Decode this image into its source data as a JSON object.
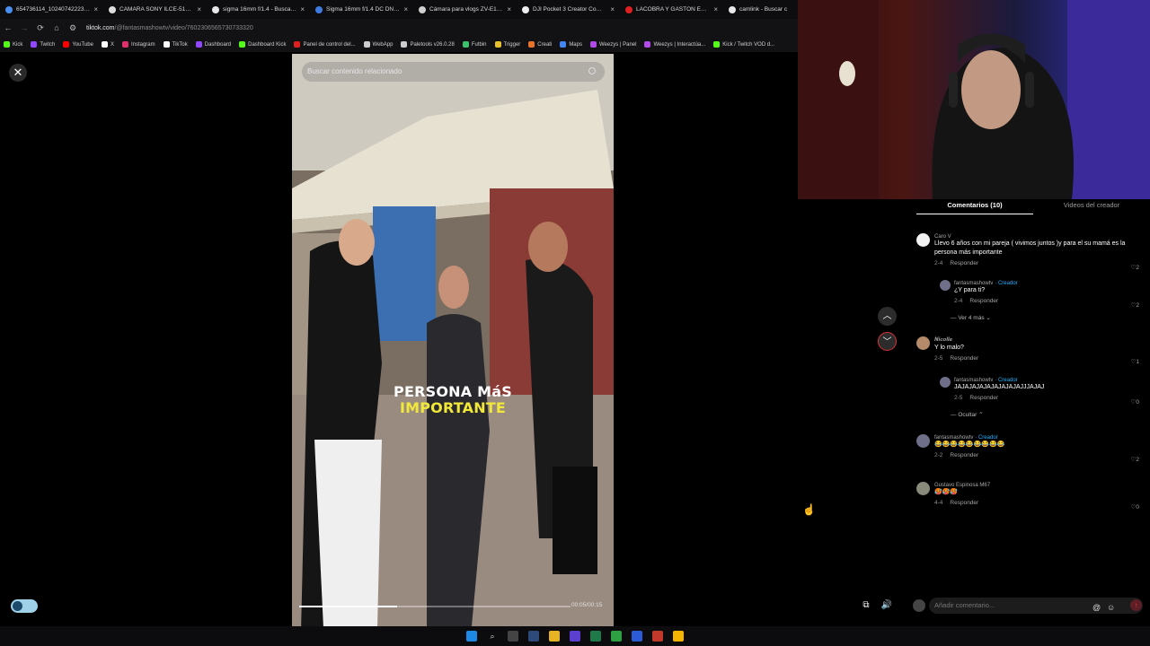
{
  "browser": {
    "tabs": [
      {
        "title": "654736114_1024074222303978...",
        "color": "#4a8ef0"
      },
      {
        "title": "CAMARA SONY ILCE-5100 -",
        "color": "#dddddd"
      },
      {
        "title": "sigma 16mm f/1.4 - Buscar co",
        "color": "#e8e8e8"
      },
      {
        "title": "Sigma 16mm f/1.4 DC DN Co",
        "color": "#3d7be0"
      },
      {
        "title": "Cámara para vlogs ZV-E10 II",
        "color": "#cfcfcf"
      },
      {
        "title": "DJI Pocket 3 Creator Combo",
        "color": "#eeeeee"
      },
      {
        "title": "LACOBRA Y GASTÓN EDUL D",
        "color": "#e02020"
      },
      {
        "title": "camlink - Buscar c",
        "color": "#e8e8e8"
      }
    ],
    "url_host": "tiktok.com",
    "url_path": "/@fantasmashowtv/video/7602306565730733320",
    "bookmarks": [
      {
        "label": "Kick",
        "color": "#53fc18"
      },
      {
        "label": "Twitch",
        "color": "#9146ff"
      },
      {
        "label": "YouTube",
        "color": "#ff0000"
      },
      {
        "label": "X",
        "color": "#ffffff"
      },
      {
        "label": "Instagram",
        "color": "#e1306c"
      },
      {
        "label": "TikTok",
        "color": "#ffffff"
      },
      {
        "label": "Dashboard",
        "color": "#9146ff"
      },
      {
        "label": "Dashboard Kick",
        "color": "#53fc18"
      },
      {
        "label": "Panel de control del...",
        "color": "#e02020"
      },
      {
        "label": "WebApp",
        "color": "#cccccc"
      },
      {
        "label": "Paletools v26.0.28",
        "color": "#cccccc"
      },
      {
        "label": "Futbin",
        "color": "#3cc26a"
      },
      {
        "label": "Trigger",
        "color": "#e6c12a"
      },
      {
        "label": "Creati",
        "color": "#e8742a"
      },
      {
        "label": "Maps",
        "color": "#4285f4"
      },
      {
        "label": "Weezys | Panel",
        "color": "#b04ae8"
      },
      {
        "label": "Weezys | Interactúa...",
        "color": "#b04ae8"
      },
      {
        "label": "Kick / Twitch VOD d...",
        "color": "#53fc18"
      }
    ]
  },
  "video": {
    "search_placeholder": "Buscar contenido relacionado",
    "caption_line1": "PERSONA MáS",
    "caption_line2": "IMPORTANTE",
    "caption_color1": "#ffffff",
    "caption_color2": "#f2e83a",
    "time": "00:05/00:15",
    "progress": 0.36
  },
  "panel": {
    "tab_comments": "Comentarios (10)",
    "tab_videos": "Videos del creador",
    "input_placeholder": "Añadir comentario...",
    "comments": [
      {
        "user": "Caro V",
        "text": "Llevo 6 años con mi pareja ( vivimos juntos )y para el su mamá es la persona más importante",
        "date": "2-4",
        "likes": "2"
      },
      {
        "user": "fantasmashowtv",
        "badge": "· Creador",
        "text": "¿Y para ti?",
        "date": "2-4",
        "likes": "2"
      },
      {
        "more": "Ver 4 más"
      },
      {
        "user": "𝑵𝒊𝒄𝒐𝒍𝒍𝒆",
        "text": "Y lo malo?",
        "date": "2-5",
        "likes": "1"
      },
      {
        "user": "fantasmashowtv",
        "badge": "· Creador",
        "text": "JAJAJAJAJAJAJAJAJAJJJAJAJ",
        "date": "2-5",
        "likes": "0"
      },
      {
        "more": "Ocultar"
      },
      {
        "user": "fantasmashowtv",
        "badge": "· Creador",
        "text": "😂😂😂😂😂😂😂😂😂",
        "date": "2-2",
        "likes": "2"
      },
      {
        "user": "Gustavo Espinosa M67",
        "text": "🥵🥵🥵",
        "date": "4-4",
        "likes": "0"
      }
    ],
    "reply_label": "Responder"
  }
}
